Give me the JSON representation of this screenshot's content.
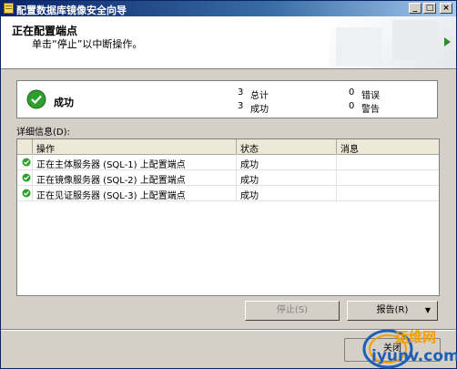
{
  "window": {
    "title": "配置数据库镜像安全向导"
  },
  "header": {
    "title": "正在配置端点",
    "subtitle": "单击“停止”以中断操作。"
  },
  "summary": {
    "status": "成功",
    "total_count": "3",
    "total_label": "总计",
    "success_count": "3",
    "success_label": "成功",
    "error_count": "0",
    "error_label": "错误",
    "warning_count": "0",
    "warning_label": "警告"
  },
  "details": {
    "label": "详细信息(D):",
    "columns": [
      "操作",
      "状态",
      "消息"
    ],
    "rows": [
      {
        "action": "正在主体服务器 (SQL-1) 上配置端点",
        "status": "成功",
        "message": ""
      },
      {
        "action": "正在镜像服务器 (SQL-2) 上配置端点",
        "status": "成功",
        "message": ""
      },
      {
        "action": "正在见证服务器 (SQL-3) 上配置端点",
        "status": "成功",
        "message": ""
      }
    ]
  },
  "buttons": {
    "stop": "停止(S)",
    "report": "报告(R)",
    "close": "关闭"
  },
  "watermark": {
    "line1": "运维网",
    "line2": "iyunv.com"
  },
  "colors": {
    "success": "#2e9e2e",
    "title_bar": "#0a246a",
    "watermark": "#f0a000"
  }
}
